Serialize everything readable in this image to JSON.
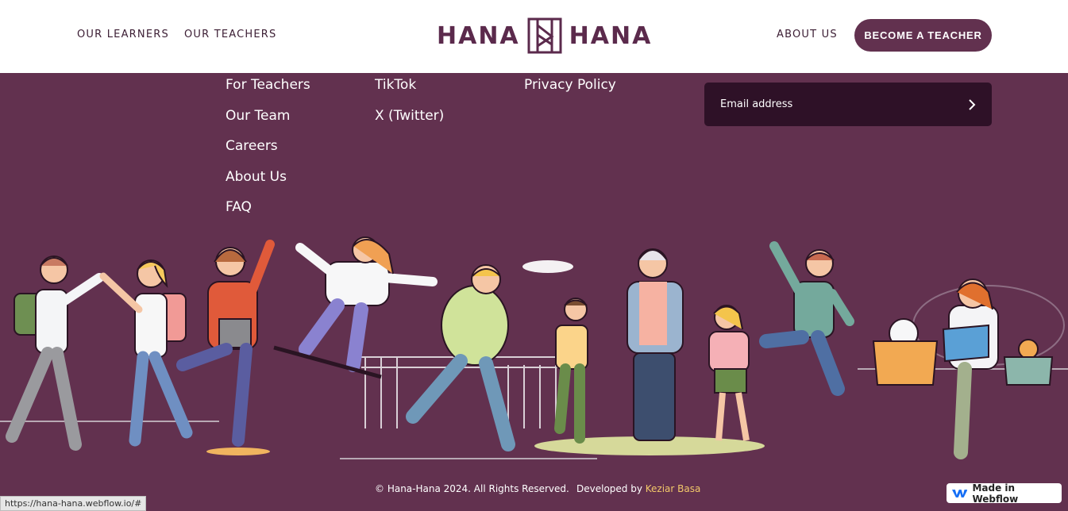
{
  "header": {
    "nav_left": [
      "OUR LEARNERS",
      "OUR TEACHERS"
    ],
    "logo_left": "HANA",
    "logo_right": "HANA",
    "about_label": "ABOUT US",
    "cta_label": "BECOME A TEACHER"
  },
  "footer": {
    "col1": [
      "For Teachers",
      "Our Team",
      "Careers",
      "About Us",
      "FAQ"
    ],
    "col2": [
      "TikTok",
      "X (Twitter)"
    ],
    "col3": [
      "Privacy Policy"
    ],
    "email_placeholder": "Email address"
  },
  "bottom": {
    "copyright": "© Hana-Hana 2024. All Rights Reserved.",
    "developed_prefix": "Developed by",
    "developer_name": "Keziar Basa",
    "status_url": "https://hana-hana.webflow.io/#",
    "badge_label": "Made in Webflow"
  },
  "colors": {
    "brand_plum": "#62314f",
    "dark_plum": "#2e1127",
    "accent_yellow": "#f2c86a"
  }
}
